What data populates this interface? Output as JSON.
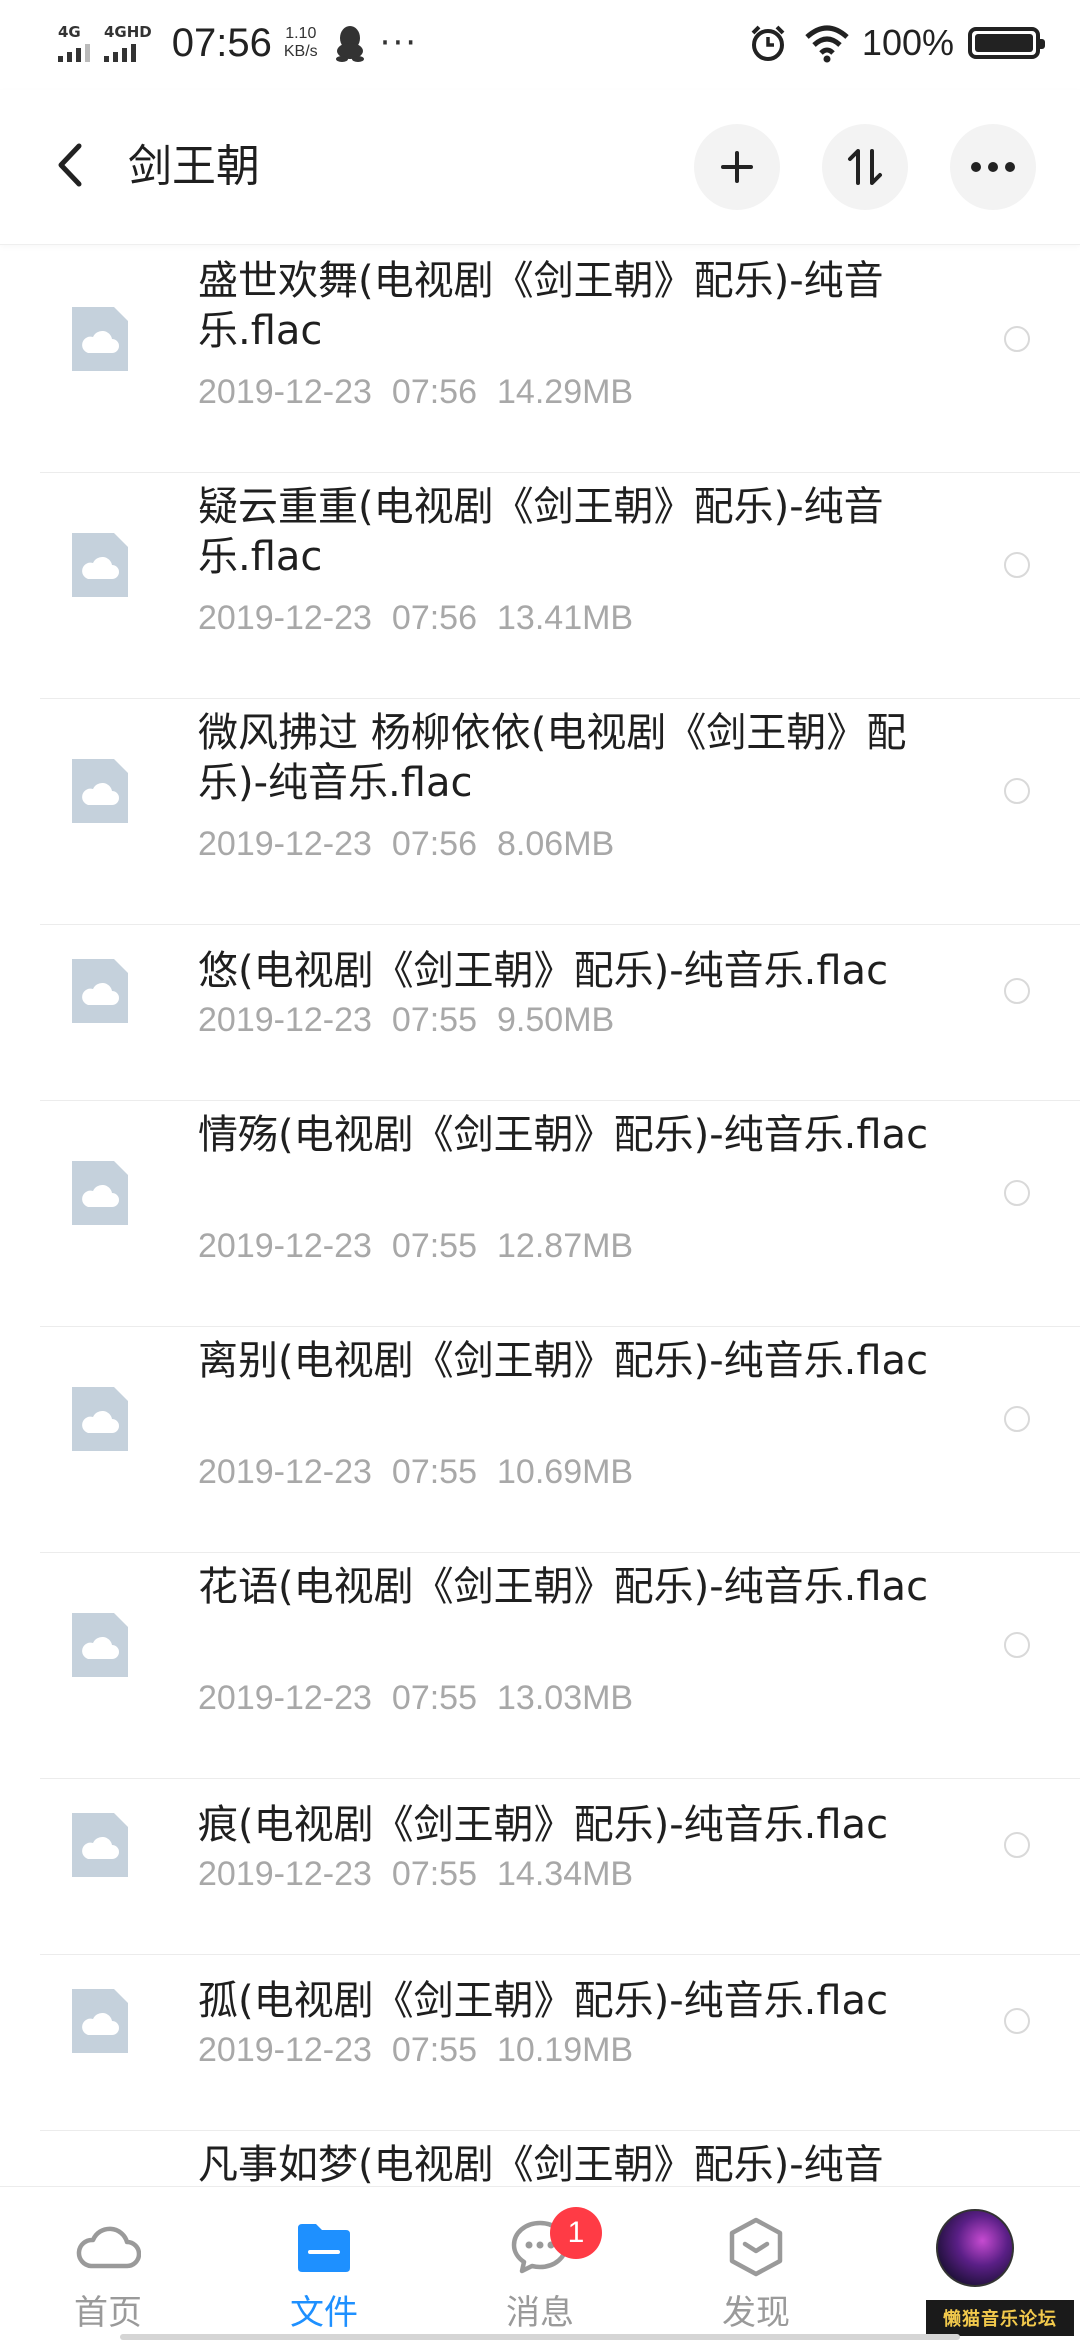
{
  "status_bar": {
    "net1": "4G",
    "net2": "4GHD",
    "time": "07:56",
    "speed_value": "1.10",
    "speed_unit": "KB/s",
    "more": "···",
    "battery": "100%"
  },
  "header": {
    "title": "剑王朝"
  },
  "files": [
    {
      "name": "盛世欢舞(电视剧《剑王朝》配乐)-纯音乐.flac",
      "date": "2019-12-23",
      "time": "07:56",
      "size": "14.29MB",
      "lines": 2
    },
    {
      "name": "疑云重重(电视剧《剑王朝》配乐)-纯音乐.flac",
      "date": "2019-12-23",
      "time": "07:56",
      "size": "13.41MB",
      "lines": 2
    },
    {
      "name": "微风拂过 杨柳依依(电视剧《剑王朝》配乐)-纯音乐.flac",
      "date": "2019-12-23",
      "time": "07:56",
      "size": "8.06MB",
      "lines": 2
    },
    {
      "name": "悠(电视剧《剑王朝》配乐)-纯音乐.flac",
      "date": "2019-12-23",
      "time": "07:55",
      "size": "9.50MB",
      "lines": 1
    },
    {
      "name": "情殇(电视剧《剑王朝》配乐)-纯音乐.flac",
      "date": "2019-12-23",
      "time": "07:55",
      "size": "12.87MB",
      "lines": 2
    },
    {
      "name": "离别(电视剧《剑王朝》配乐)-纯音乐.flac",
      "date": "2019-12-23",
      "time": "07:55",
      "size": "10.69MB",
      "lines": 2
    },
    {
      "name": "花语(电视剧《剑王朝》配乐)-纯音乐.flac",
      "date": "2019-12-23",
      "time": "07:55",
      "size": "13.03MB",
      "lines": 2
    },
    {
      "name": "痕(电视剧《剑王朝》配乐)-纯音乐.flac",
      "date": "2019-12-23",
      "time": "07:55",
      "size": "14.34MB",
      "lines": 1
    },
    {
      "name": "孤(电视剧《剑王朝》配乐)-纯音乐.flac",
      "date": "2019-12-23",
      "time": "07:55",
      "size": "10.19MB",
      "lines": 1
    },
    {
      "name": "凡事如梦(电视剧《剑王朝》配乐)-纯音乐.flac",
      "date": "",
      "time": "",
      "size": "",
      "lines": 2
    }
  ],
  "bottom_nav": {
    "home": "首页",
    "files": "文件",
    "messages": "消息",
    "messages_badge": "1",
    "discover": "发现"
  },
  "watermark": "懒猫音乐论坛",
  "colors": {
    "accent": "#1e90ff",
    "badge": "#ff3b45",
    "thumb": "#c5d1dc",
    "meta": "#a8a8a8"
  }
}
